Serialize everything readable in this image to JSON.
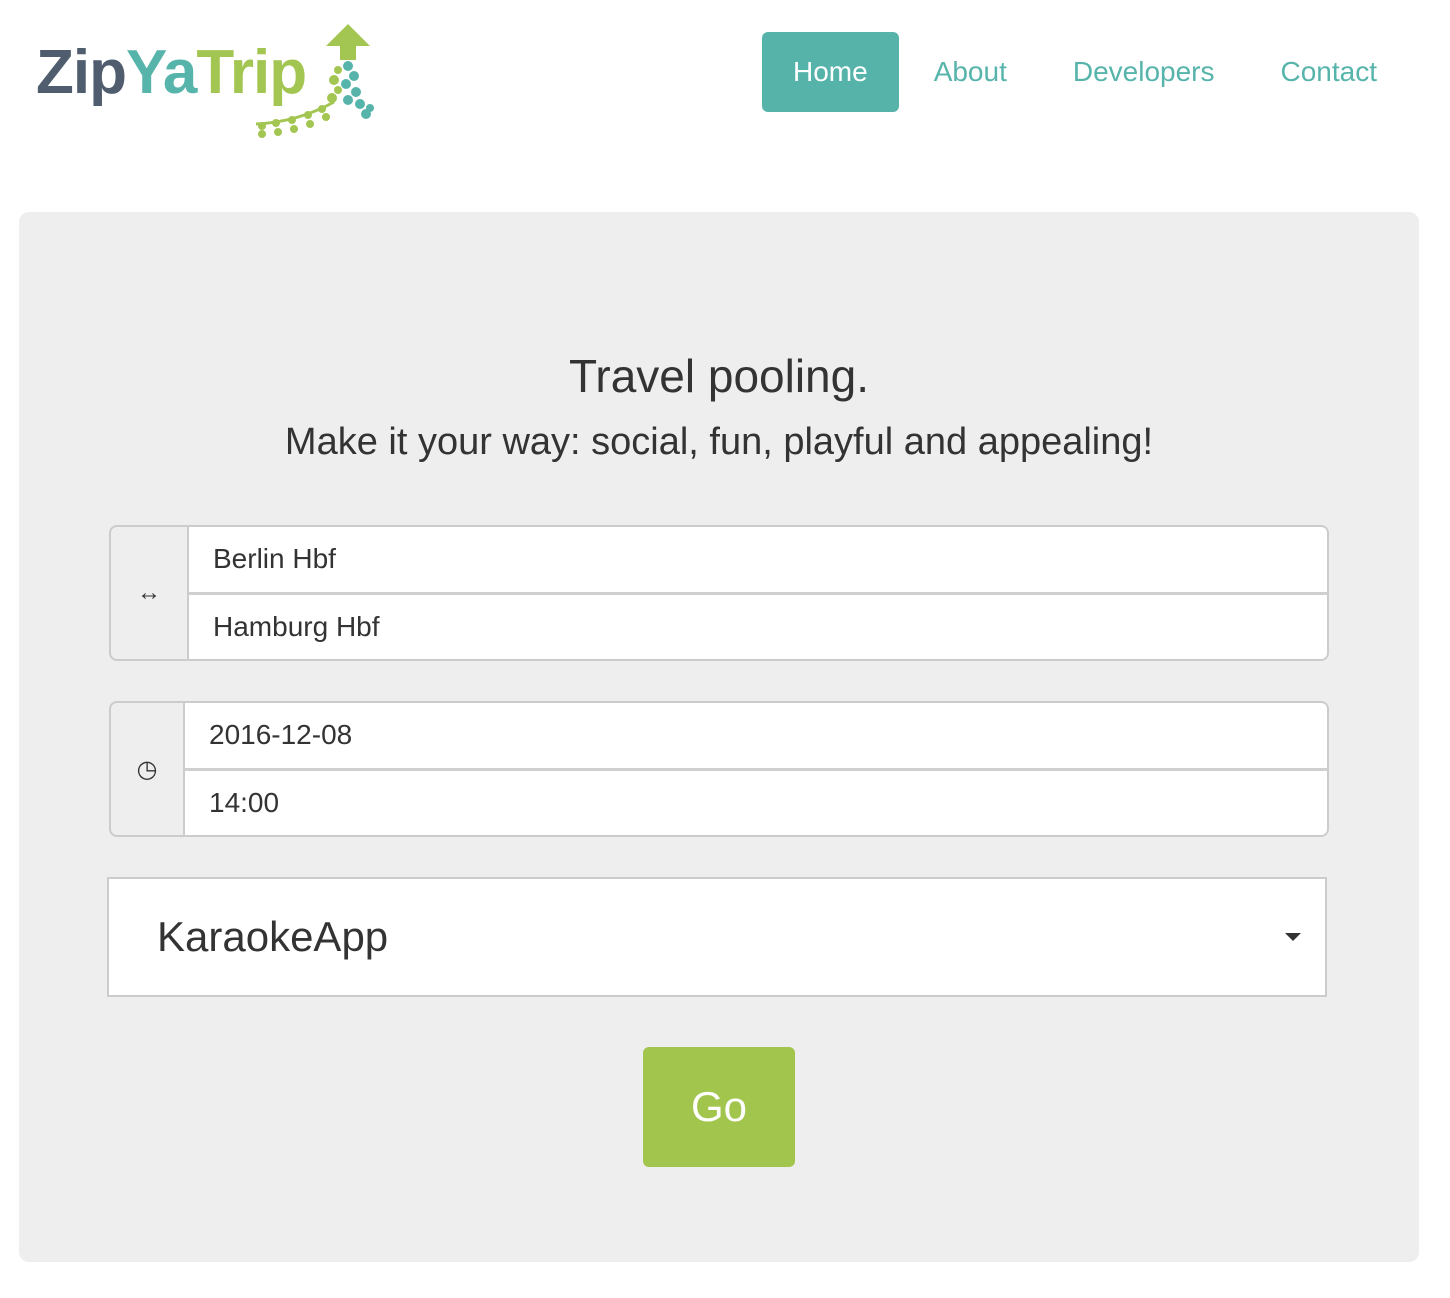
{
  "brand": {
    "part1": "Zip",
    "part2": "Ya",
    "part3": "Trip",
    "colors": {
      "zip": "#4f5d6e",
      "ya": "#56b4ab",
      "trip": "#a3c652"
    },
    "mark_icon": "arrow-up-confetti-icon"
  },
  "nav": {
    "items": [
      {
        "label": "Home",
        "active": true
      },
      {
        "label": "About",
        "active": false
      },
      {
        "label": "Developers",
        "active": false
      },
      {
        "label": "Contact",
        "active": false
      }
    ],
    "active_color": "#55b3aa"
  },
  "hero": {
    "title": "Travel pooling.",
    "subtitle": "Make it your way: social, fun, playful and appealing!",
    "background": "#eeeeee"
  },
  "route": {
    "icon": "↔",
    "icon_name": "swap-arrows-icon",
    "from": "Berlin Hbf",
    "to": "Hamburg Hbf"
  },
  "time": {
    "icon": "◷",
    "icon_name": "clock-icon",
    "date": "2016-12-08",
    "time": "14:00"
  },
  "app_select": {
    "selected": "KaraokeApp"
  },
  "go_button": {
    "label": "Go",
    "color": "#a2c54e"
  }
}
